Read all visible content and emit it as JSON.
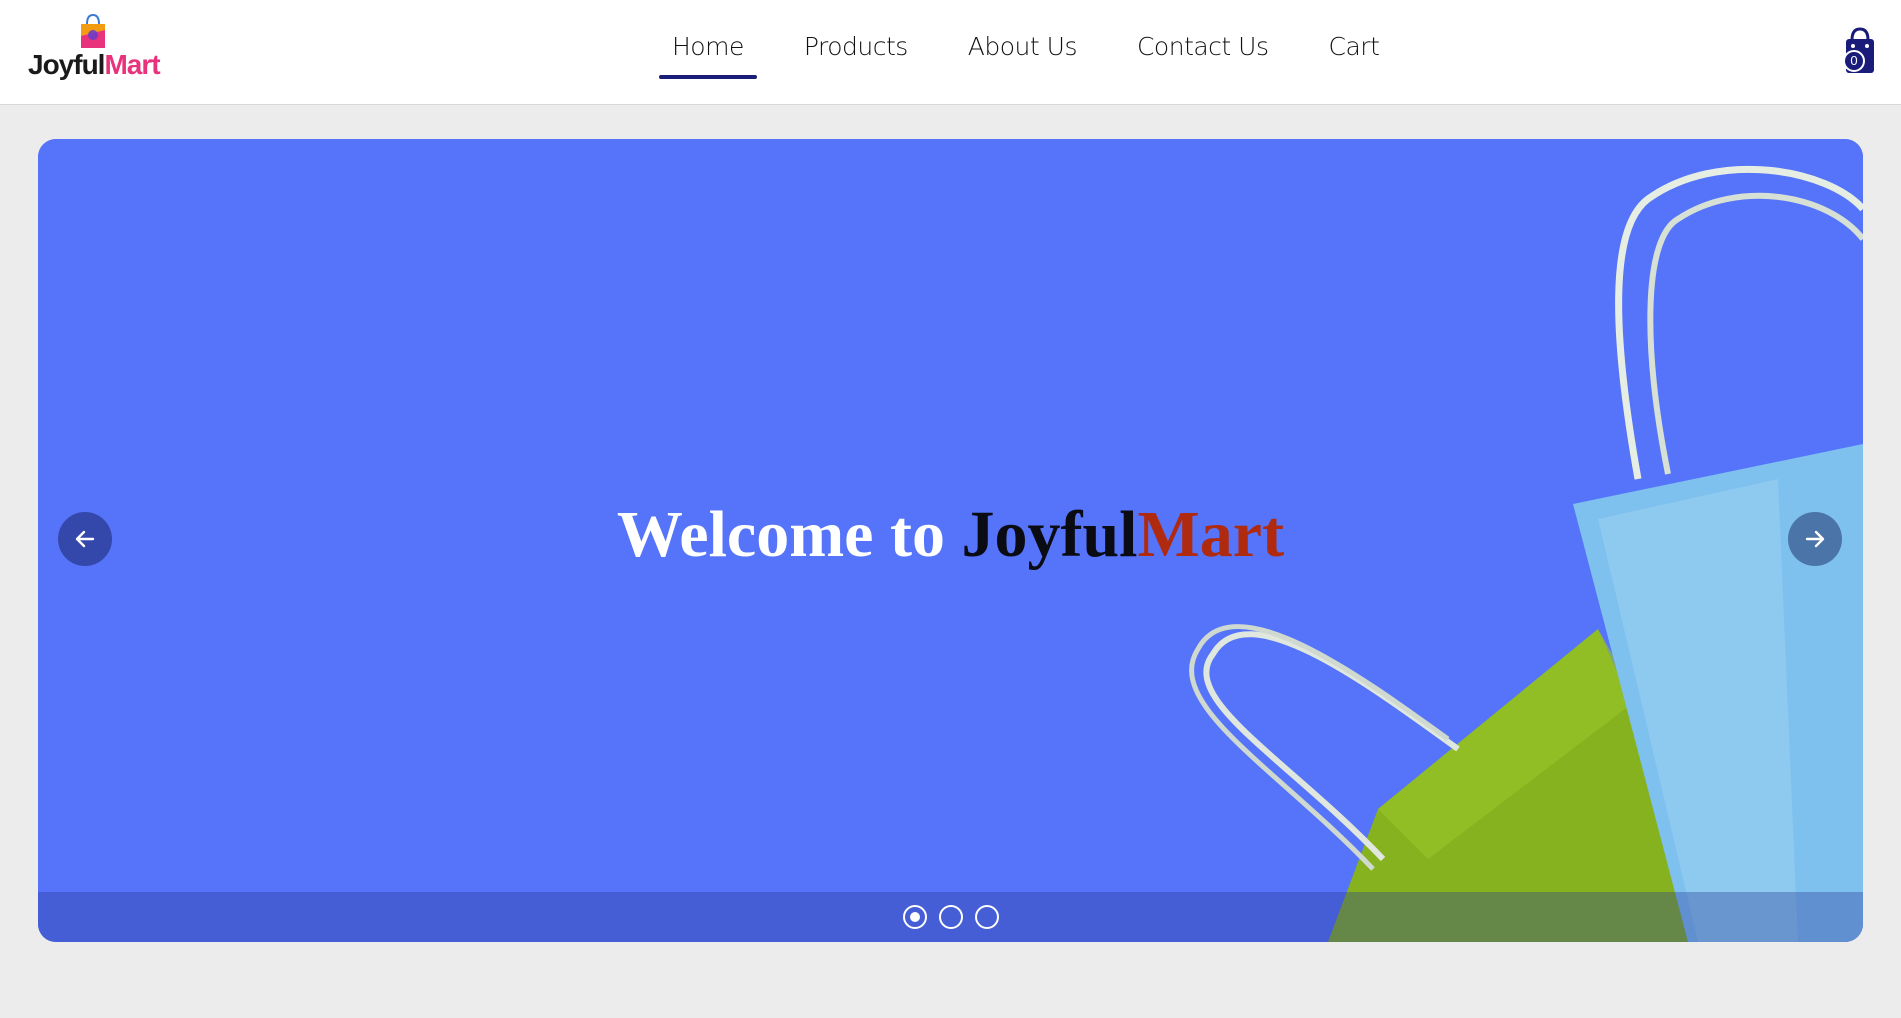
{
  "brand": {
    "name_part1": "Joyful",
    "name_part2": "Mart",
    "logo_icon": "shopping-bag-logo",
    "color_part2": "#e8337c"
  },
  "nav": {
    "items": [
      {
        "label": "Home",
        "active": true
      },
      {
        "label": "Products",
        "active": false
      },
      {
        "label": "About Us",
        "active": false
      },
      {
        "label": "Contact Us",
        "active": false
      },
      {
        "label": "Cart",
        "active": false
      }
    ],
    "active_indicator_color": "#1a1c7a"
  },
  "cart": {
    "icon": "shopping-bag-icon",
    "count": "0"
  },
  "hero": {
    "title_part1": "Welcome to ",
    "title_part2": "Joyful",
    "title_part3": "Mart",
    "background_color": "#5574f9",
    "prev_icon": "arrow-left-icon",
    "next_icon": "arrow-right-icon",
    "slide_count": 3,
    "active_slide": 1
  }
}
